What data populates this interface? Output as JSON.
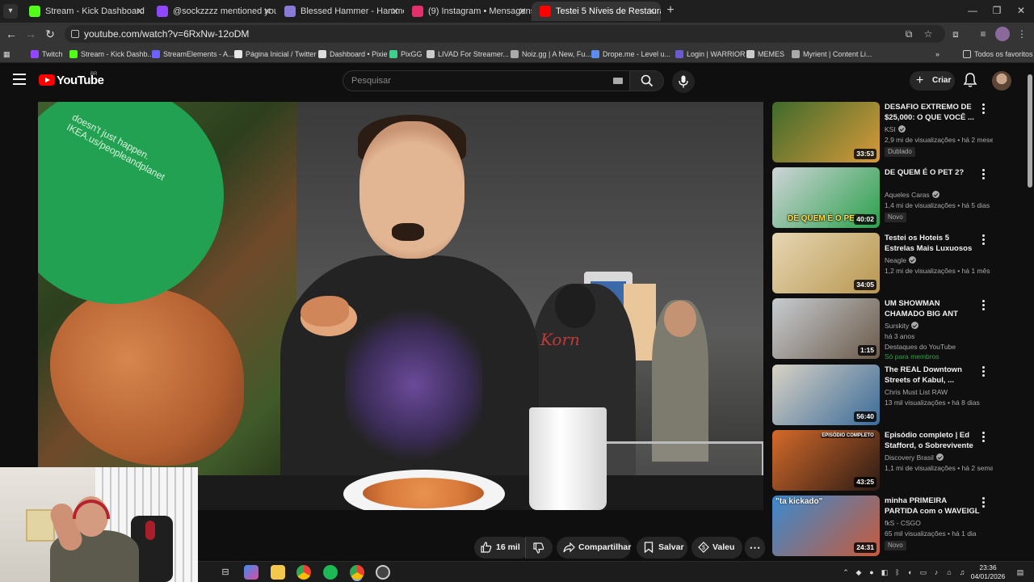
{
  "browser": {
    "tabs": [
      {
        "title": "Stream - Kick Dashboard",
        "icon": "kick-icon",
        "color": "#53fc18",
        "active": false
      },
      {
        "title": "@sockzzzz mentioned you",
        "icon": "twitch-icon",
        "color": "#9146ff",
        "active": false
      },
      {
        "title": "Blessed Hammer - Hammerkun",
        "icon": "maxroll-icon",
        "color": "#8a7ad8",
        "active": false
      },
      {
        "title": "(9) Instagram • Mensagens",
        "icon": "instagram-icon",
        "color": "#e1306c",
        "active": false
      },
      {
        "title": "Testei 5 Níveis de Restaurantes",
        "icon": "youtube-icon",
        "color": "#ff0000",
        "active": true
      }
    ],
    "url": "youtube.com/watch?v=6RxNw-12oDM",
    "bookmarks": [
      {
        "label": "Twitch",
        "icon": "twitch-icon",
        "color": "#9146ff"
      },
      {
        "label": "Stream - Kick Dashb...",
        "icon": "kick-icon",
        "color": "#53fc18"
      },
      {
        "label": "StreamElements - A...",
        "icon": "streamelements-icon",
        "color": "#6b63ff"
      },
      {
        "label": "Página Inicial / Twitter",
        "icon": "x-icon",
        "color": "#e7e7e7"
      },
      {
        "label": "Dashboard • Pixie",
        "icon": "pixie-icon",
        "color": "#dddddd"
      },
      {
        "label": "PixGG",
        "icon": "pixgg-icon",
        "color": "#3ecf8e"
      },
      {
        "label": "LIVAD For Streamer...",
        "icon": "livad-icon",
        "color": "#cccccc"
      },
      {
        "label": "Noiz.gg | A New, Fu...",
        "icon": "noiz-icon",
        "color": "#aaaaaa"
      },
      {
        "label": "Drope.me - Level u...",
        "icon": "drope-icon",
        "color": "#5a8dee"
      },
      {
        "label": "Login | WARRIOR",
        "icon": "warrior-icon",
        "color": "#6a5acd"
      },
      {
        "label": "MEMES",
        "icon": "folder-icon",
        "color": "#cccccc"
      },
      {
        "label": "Myrient | Content Li...",
        "icon": "myrient-icon",
        "color": "#aaaaaa"
      }
    ],
    "all_bookmarks": "Todos os favoritos"
  },
  "youtube": {
    "wordmark": "YouTube",
    "country": "BR",
    "search_placeholder": "Pesquisar",
    "create_label": "Criar",
    "video_overlay_text": "doesn't just happen. IKEA.us/peopleandplanet",
    "actions": {
      "likes": "16 mil",
      "share": "Compartilhar",
      "save": "Salvar",
      "thanks": "Valeu"
    },
    "recommendations": [
      {
        "title": "DESAFIO EXTREMO DE $25,000: O QUE VOCÊ ...",
        "channel": "KSI",
        "verified": true,
        "meta": "2,9 mi de visualizações • há 2 meses",
        "badge": "Dublado",
        "duration": "33:53",
        "thumb_colors": [
          "#3f6a2b",
          "#d89a3a"
        ]
      },
      {
        "title": "DE QUEM É O PET 2?",
        "channel": "Aqueles Caras",
        "verified": true,
        "meta": "1,4 mi de visualizações • há 5 dias",
        "badge": "Novo",
        "duration": "40:02",
        "thumb_caption": "DE QUEM É O PET?",
        "thumb_colors": [
          "#cfd4d8",
          "#2aa14a"
        ]
      },
      {
        "title": "Testei os Hoteis 5 Estrelas Mais Luxuosos do Mundo",
        "channel": "Neagle",
        "verified": true,
        "meta": "1,2 mi de visualizações • há 1 mês",
        "duration": "34:05",
        "thumb_colors": [
          "#e7d6b4",
          "#b8974f"
        ]
      },
      {
        "title": "UM SHOWMAN CHAMADO BIG ANT",
        "channel": "Surskity",
        "verified": true,
        "meta": "há 3 anos",
        "meta2": "Destaques do YouTube",
        "members": "Só para membros",
        "duration": "1:15",
        "thumb_colors": [
          "#c7ccd0",
          "#6b5a4a"
        ]
      },
      {
        "title": "The REAL Downtown Streets of Kabul, ...",
        "channel": "Chris Must List RAW",
        "verified": false,
        "meta": "13 mil visualizações • há 8 dias",
        "duration": "56:40",
        "thumb_colors": [
          "#d8d2c4",
          "#3a6b9a"
        ]
      },
      {
        "title": "Episódio completo | Ed Stafford, o Sobrevivente ...",
        "channel": "Discovery Brasil",
        "verified": true,
        "meta": "1,1 mi de visualizações • há 2 semanas",
        "duration": "43:25",
        "thumb_caption": "EPISÓDIO COMPLETO",
        "thumb_colors": [
          "#d46a2a",
          "#2a1a14"
        ]
      },
      {
        "title": "minha PRIMEIRA PARTIDA com o WAVEIGL depois d...",
        "channel": "fkS - CSGO",
        "verified": false,
        "meta": "65 mil visualizações • há 1 dia",
        "badge": "Novo",
        "duration": "24:31",
        "thumb_caption": "\"ta kickado\"",
        "thumb_colors": [
          "#3a8ad0",
          "#c85a3a"
        ]
      }
    ]
  },
  "taskbar": {
    "time": "23:36",
    "date": "04/01/2026"
  }
}
